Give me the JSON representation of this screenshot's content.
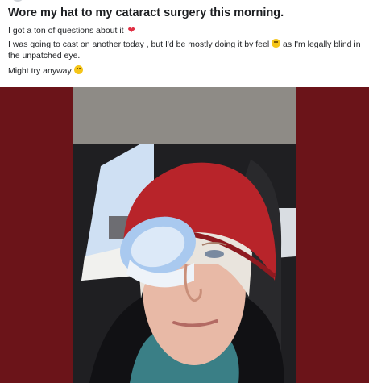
{
  "post": {
    "title": "Wore my hat to my cataract surgery this morning.",
    "line1": "I got a ton of questions about it",
    "line2_part1": "I was going to cast on another today , but I'd be mostly doing it by feel",
    "line2_part2": "as I'm legally blind in the unpatched eye.",
    "line3": "Might try anyway"
  },
  "icons": {
    "heart": "heart-emoji",
    "laugh": "rofl-emoji",
    "thinking": "thinking-emoji"
  },
  "colors": {
    "backdrop": "#6b1419",
    "hat": "#b8242a",
    "eye_shield": "#a9c9ef"
  }
}
